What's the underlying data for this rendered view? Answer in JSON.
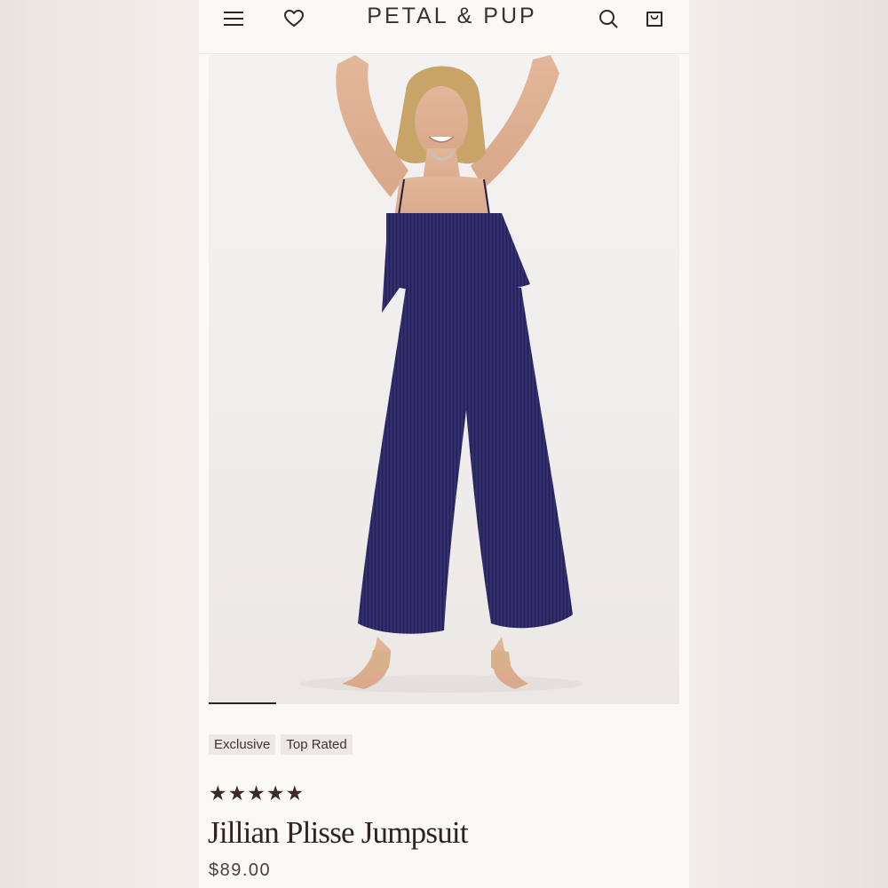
{
  "header": {
    "brand": "PETAL & PUP",
    "icons": [
      "menu-icon",
      "heart-icon",
      "search-icon",
      "bag-icon"
    ]
  },
  "gallery": {
    "active_index": 1
  },
  "product": {
    "badges": [
      "Exclusive",
      "Top Rated"
    ],
    "rating_stars": "★★★★★",
    "rating": 5,
    "name": "Jillian Plisse Jumpsuit",
    "price": "$89.00"
  },
  "colors": {
    "background": "#fbf9f6",
    "text": "#2e2522",
    "badge_bg": "#ece9e5",
    "garment": "#2c2960"
  }
}
